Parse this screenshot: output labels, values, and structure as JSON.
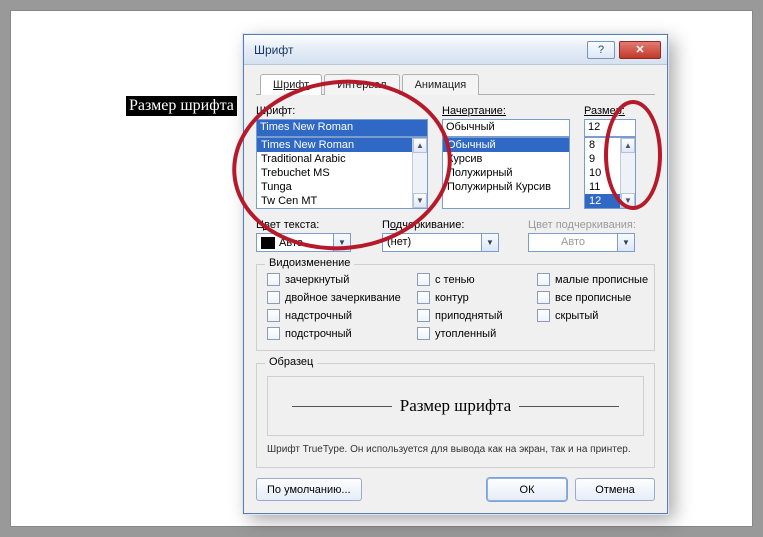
{
  "doc": {
    "selected_text": "Размер шрифта"
  },
  "dialog": {
    "title": "Шрифт",
    "tabs": [
      "Шрифт",
      "Интервал",
      "Анимация"
    ],
    "active_tab": 0,
    "font": {
      "label": "Шрифт:",
      "value": "Times New Roman",
      "list": [
        "Times New Roman",
        "Traditional Arabic",
        "Trebuchet MS",
        "Tunga",
        "Tw Cen MT"
      ],
      "selected_index": 0
    },
    "style": {
      "label": "Начертание:",
      "value": "Обычный",
      "list": [
        "Обычный",
        "Курсив",
        "Полужирный",
        "Полужирный Курсив"
      ],
      "selected_index": 0
    },
    "size": {
      "label": "Размер:",
      "value": "12",
      "list": [
        "8",
        "9",
        "10",
        "11",
        "12"
      ],
      "selected_index": 4
    },
    "color": {
      "label_pre": "Ц",
      "label_u": "в",
      "label_post": "ет текста:",
      "value": "Авто"
    },
    "underline": {
      "label_pre": "П",
      "label_u": "о",
      "label_post": "дчеркивание:",
      "value": "(нет)"
    },
    "underline_color": {
      "label": "Цвет подчеркивания:",
      "value": "Авто"
    },
    "effects": {
      "title": "Видоизменение",
      "items": [
        "зачеркнутый",
        "с тенью",
        "малые прописные",
        "двойное зачеркивание",
        "контур",
        "все прописные",
        "надстрочный",
        "приподнятый",
        "скрытый",
        "подстрочный",
        "утопленный"
      ]
    },
    "preview": {
      "title": "Образец",
      "text": "Размер шрифта"
    },
    "hint": "Шрифт TrueType. Он используется для вывода как на экран, так и на принтер.",
    "buttons": {
      "default": "По умолчанию...",
      "ok": "ОК",
      "cancel": "Отмена"
    }
  }
}
